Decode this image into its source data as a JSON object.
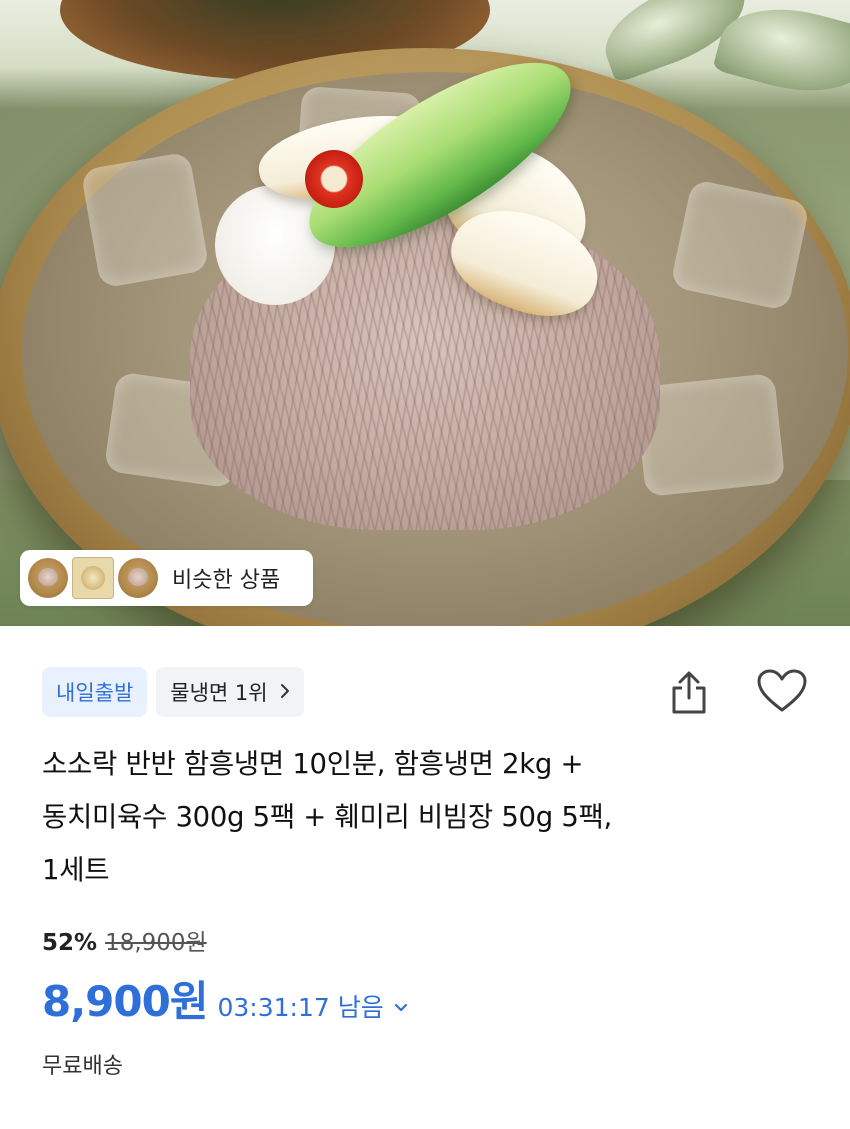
{
  "similar": {
    "label": "비슷한 상품"
  },
  "badges": {
    "departure": "내일출발",
    "ranking": "물냉면 1위"
  },
  "icons": {
    "share": "share-icon",
    "heart": "heart-icon",
    "chevron": "chevron-right-icon",
    "dropdown": "chevron-down-icon"
  },
  "product": {
    "title_line1": "소소락 반반 함흥냉면 10인분, 함흥냉면 2kg +",
    "title_line2": "동치미육수 300g 5팩 + 훼미리 비빔장 50g 5팩,",
    "title_line3": "1세트"
  },
  "pricing": {
    "discount": "52%",
    "original_price": "18,900원",
    "price": "8,900원",
    "timer": "03:31:17 남음"
  },
  "shipping": "무료배송",
  "colors": {
    "accent": "#2f6fd9",
    "badge_bg": "#e8f1fd"
  }
}
